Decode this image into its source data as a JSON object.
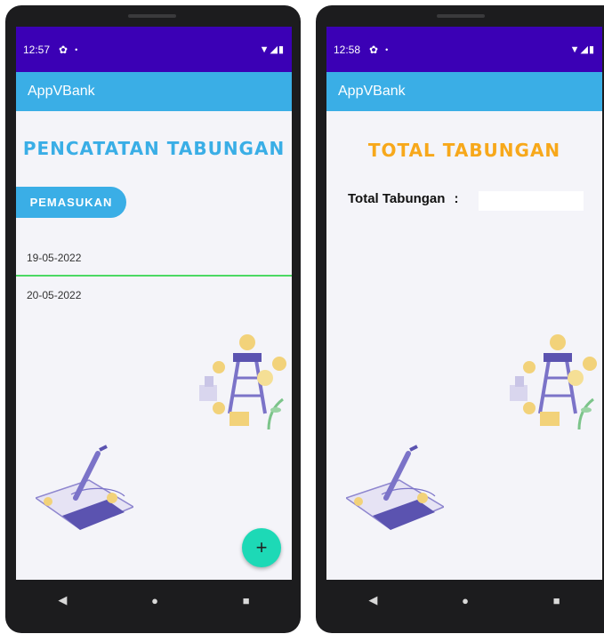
{
  "screens": [
    {
      "status": {
        "time": "12:57",
        "dot": "•"
      },
      "appbar_title": "AppVBank",
      "hero_title": "PENCATATAN TABUNGAN",
      "income_button": "PEMASUKAN",
      "dates": [
        "19-05-2022",
        "20-05-2022"
      ],
      "fab_label": "+"
    },
    {
      "status": {
        "time": "12:58",
        "dot": "•"
      },
      "appbar_title": "AppVBank",
      "hero_title": "TOTAL TABUNGAN",
      "total_label": "Total Tabungan",
      "total_sep": ":"
    }
  ],
  "icons": {
    "settings": "gear-icon",
    "wifi": "wifi-icon",
    "signal": "signal-icon",
    "battery": "battery-icon",
    "back": "back-nav-icon",
    "home": "home-nav-icon",
    "recents": "recents-nav-icon"
  },
  "colors": {
    "statusbar": "#3b00b5",
    "appbar": "#3aaee6",
    "title_blue": "#3aaee6",
    "title_orange": "#f7a81b",
    "fab": "#1dd9b6",
    "divider": "#4cd964"
  }
}
